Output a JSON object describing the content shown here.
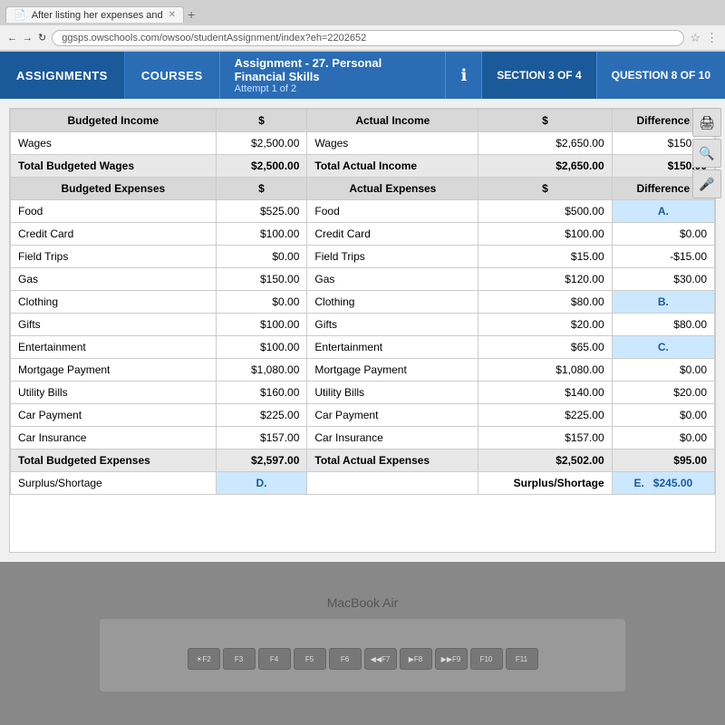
{
  "browser": {
    "tab1_text": "After listing her expenses and",
    "tab2_text": "+",
    "address": "ggsps.owschools.com/owsoo/studentAssignment/index?eh=2202652"
  },
  "header": {
    "assignments_label": "ASSIGNMENTS",
    "courses_label": "COURSES",
    "assignment_title": "Assignment - 27. Personal Financial Skills",
    "attempt": "Attempt 1 of 2",
    "section": "SECTION 3 OF 4",
    "question": "QUESTION 8 OF 10"
  },
  "table": {
    "col_headers": [
      "Budgeted Income",
      "$",
      "Actual Income",
      "$",
      "Difference"
    ],
    "income_rows": [
      {
        "label": "Wages",
        "budgeted": "$2,500.00",
        "actual_label": "Wages",
        "actual": "$2,650.00",
        "diff": "$150.00"
      },
      {
        "label": "Total Budgeted Wages",
        "budgeted": "$2,500.00",
        "actual_label": "Total Actual Income",
        "actual": "$2,650.00",
        "diff": "$150.00"
      }
    ],
    "expense_headers": [
      "Budgeted Expenses",
      "$",
      "Actual Expenses",
      "$",
      "Difference"
    ],
    "expense_rows": [
      {
        "label": "Food",
        "budgeted": "$525.00",
        "actual_label": "Food",
        "actual": "$500.00",
        "diff": "A."
      },
      {
        "label": "Credit Card",
        "budgeted": "$100.00",
        "actual_label": "Credit Card",
        "actual": "$100.00",
        "diff": "$0.00"
      },
      {
        "label": "Field Trips",
        "budgeted": "$0.00",
        "actual_label": "Field Trips",
        "actual": "$15.00",
        "diff": "-$15.00"
      },
      {
        "label": "Gas",
        "budgeted": "$150.00",
        "actual_label": "Gas",
        "actual": "$120.00",
        "diff": "$30.00"
      },
      {
        "label": "Clothing",
        "budgeted": "$0.00",
        "actual_label": "Clothing",
        "actual": "$80.00",
        "diff": "B."
      },
      {
        "label": "Gifts",
        "budgeted": "$100.00",
        "actual_label": "Gifts",
        "actual": "$20.00",
        "diff": "$80.00"
      },
      {
        "label": "Entertainment",
        "budgeted": "$100.00",
        "actual_label": "Entertainment",
        "actual": "$65.00",
        "diff": "C."
      },
      {
        "label": "Mortgage Payment",
        "budgeted": "$1,080.00",
        "actual_label": "Mortgage Payment",
        "actual": "$1,080.00",
        "diff": "$0.00"
      },
      {
        "label": "Utility Bills",
        "budgeted": "$160.00",
        "actual_label": "Utility Bills",
        "actual": "$140.00",
        "diff": "$20.00"
      },
      {
        "label": "Car Payment",
        "budgeted": "$225.00",
        "actual_label": "Car Payment",
        "actual": "$225.00",
        "diff": "$0.00"
      },
      {
        "label": "Car Insurance",
        "budgeted": "$157.00",
        "actual_label": "Car Insurance",
        "actual": "$157.00",
        "diff": "$0.00"
      },
      {
        "label": "Total Budgeted Expenses",
        "budgeted": "$2,597.00",
        "actual_label": "Total Actual Expenses",
        "actual": "$2,502.00",
        "diff": "$95.00"
      }
    ],
    "surplus_label": "Surplus/Shortage",
    "surplus_answer_d": "D.",
    "surplus_actual_label": "Surplus/Shortage",
    "surplus_answer_e": "E.",
    "surplus_value": "$245.00"
  },
  "laptop": {
    "label": "MacBook Air"
  },
  "icons": {
    "print": "🖨",
    "search": "🔍",
    "mic": "🎤"
  }
}
